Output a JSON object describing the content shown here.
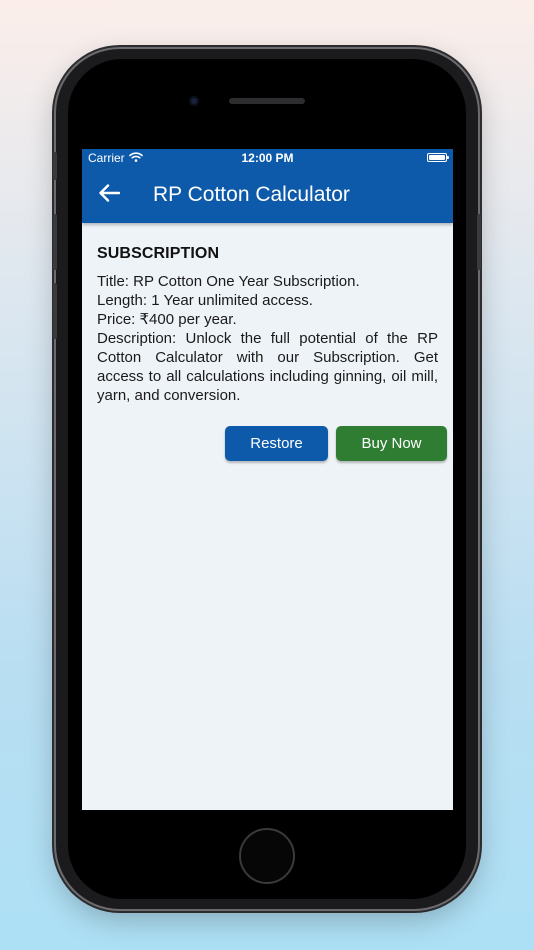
{
  "status_bar": {
    "carrier": "Carrier",
    "time": "12:00 PM"
  },
  "app_bar": {
    "title": "RP Cotton Calculator",
    "back_icon": "arrow-left-icon"
  },
  "subscription": {
    "heading": "SUBSCRIPTION",
    "title_line": "Title: RP Cotton One Year Subscription.",
    "length_line": "Length: 1 Year unlimited access.",
    "price_line": "Price: ₹400 per year.",
    "description_line": "Description: Unlock the full potential of the RP Cotton Calculator with our Subscription. Get access to all calculations including ginning, oil mill, yarn, and conversion."
  },
  "actions": {
    "restore_label": "Restore",
    "buy_label": "Buy Now"
  },
  "colors": {
    "primary": "#0e5aaa",
    "buy": "#2e7d32",
    "screen_bg": "#eef3f8"
  }
}
